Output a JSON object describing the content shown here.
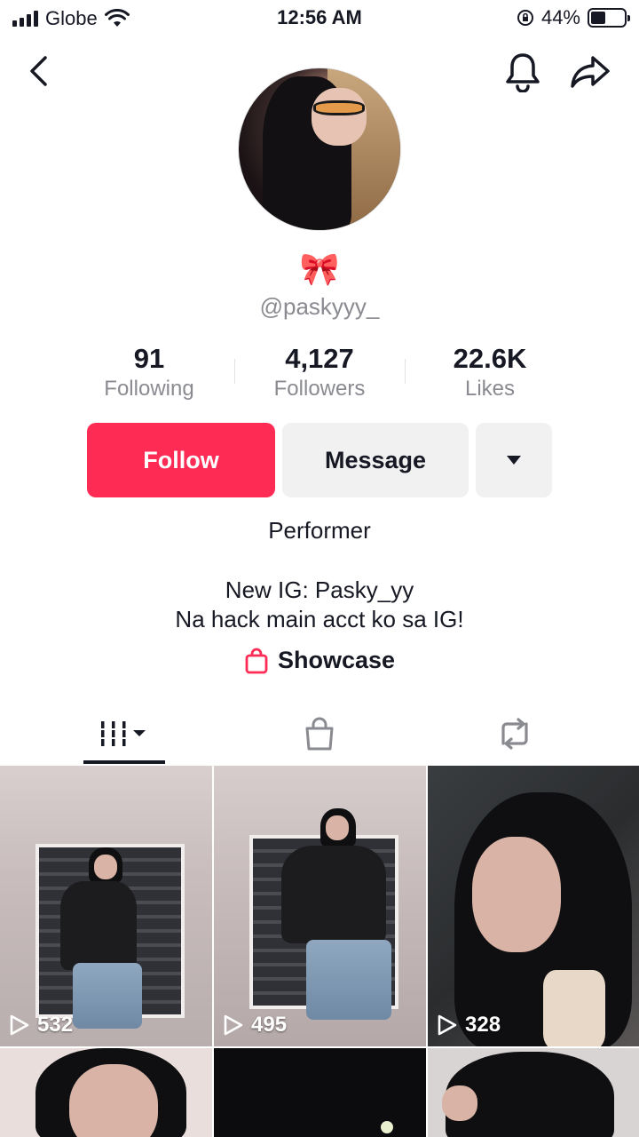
{
  "status_bar": {
    "carrier": "Globe",
    "time": "12:56 AM",
    "battery": "44%",
    "battery_level": 0.44
  },
  "icons": {
    "back": "chevron-left-icon",
    "notifications": "bell-icon",
    "share": "share-arrow-icon",
    "more": "caret-down-icon",
    "showcase": "shopping-bag-icon"
  },
  "profile": {
    "emoji": "🎀",
    "handle": "@paskyyy_",
    "stats": [
      {
        "value": "91",
        "label": "Following"
      },
      {
        "value": "4,127",
        "label": "Followers"
      },
      {
        "value": "22.6K",
        "label": "Likes"
      }
    ],
    "category": "Performer",
    "bio_lines": [
      "New IG: Pasky_yy",
      "Na hack main acct ko sa IG!"
    ],
    "showcase_label": "Showcase"
  },
  "actions": {
    "follow_label": "Follow",
    "message_label": "Message"
  },
  "tabs": [
    {
      "icon": "videos-grid-icon",
      "selected": true
    },
    {
      "icon": "shopping-bag-icon",
      "selected": false
    },
    {
      "icon": "repost-icon",
      "selected": false
    }
  ],
  "videos": [
    {
      "views": "532"
    },
    {
      "views": "495"
    },
    {
      "views": "328"
    }
  ],
  "colors": {
    "accent": "#fe2c55",
    "text": "#161823",
    "muted": "#8a8b91",
    "button_gray": "#f1f1f2"
  }
}
